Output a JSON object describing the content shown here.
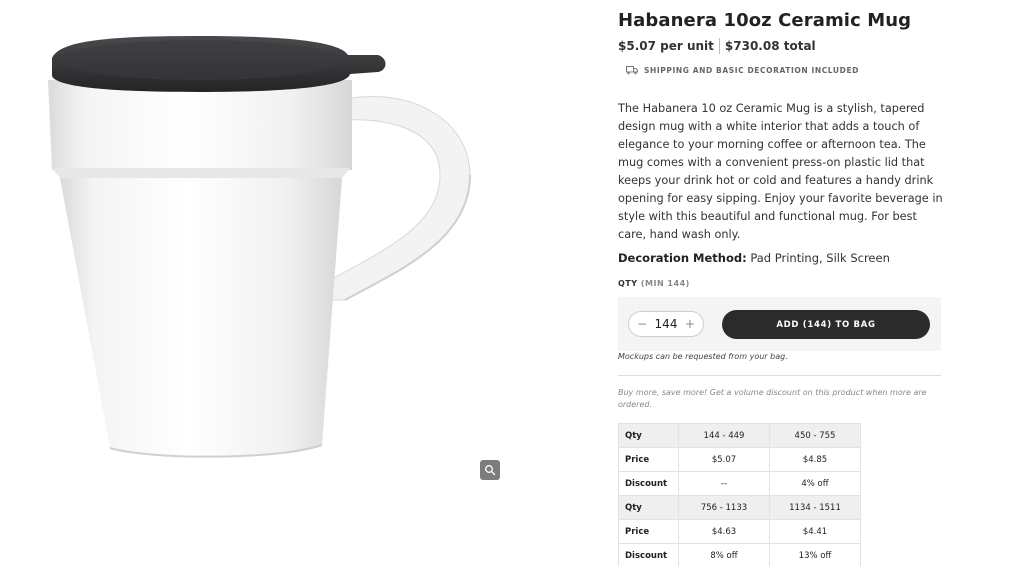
{
  "product": {
    "title": "Habanera 10oz Ceramic Mug",
    "unit_price": "$5.07 per unit",
    "total_price": "$730.08 total",
    "shipping_note": "SHIPPING AND BASIC DECORATION INCLUDED",
    "description": "The Habanera 10 oz Ceramic Mug is a stylish, tapered design mug with a white interior that adds a touch of elegance to your morning coffee or afternoon tea. The mug comes with a convenient press-on plastic lid that keeps your drink hot or cold and features a handy drink opening for easy sipping. Enjoy your favorite beverage in style with this beautiful and functional mug. For best care, hand wash only.",
    "decoration_label": "Decoration Method:",
    "decoration_value": "Pad Printing, Silk Screen"
  },
  "order": {
    "qty_label": "QTY",
    "qty_min": "(MIN 144)",
    "minus": "−",
    "plus": "+",
    "qty_value": "144",
    "add_button": "ADD (144) TO BAG",
    "mockup_note": "Mockups can be requested from your bag.",
    "volume_note": "Buy more, save more! Get a volume discount on this product when more are ordered."
  },
  "pricing_table": {
    "rows": [
      {
        "label": "Qty",
        "cells": [
          "144 - 449",
          "450 - 755"
        ]
      },
      {
        "label": "Price",
        "cells": [
          "$5.07",
          "$4.85"
        ]
      },
      {
        "label": "Discount",
        "cells": [
          "--",
          "4% off"
        ]
      },
      {
        "label": "Qty",
        "cells": [
          "756 - 1133",
          "1134 - 1511"
        ]
      },
      {
        "label": "Price",
        "cells": [
          "$4.63",
          "$4.41"
        ]
      },
      {
        "label": "Discount",
        "cells": [
          "8% off",
          "13% off"
        ]
      }
    ]
  },
  "icons": {
    "zoom": "magnifier-icon",
    "shipping": "truck-icon"
  },
  "colors": {
    "button_bg": "#2b2b2b",
    "lid": "#2f3033",
    "mug_body": "#ffffff",
    "qty_box_bg": "#f4f4f4"
  }
}
